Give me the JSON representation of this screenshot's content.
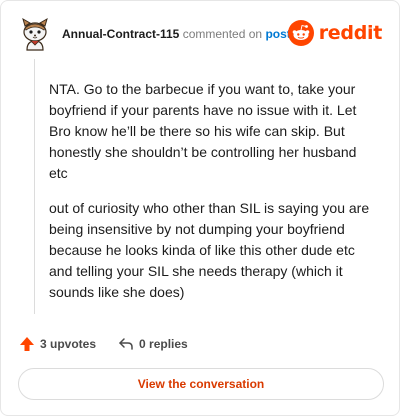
{
  "comment": {
    "username": "Annual-Contract-115",
    "commented_text": "commented on",
    "post_link": "post",
    "paragraphs": [
      "NTA. Go to the barbecue if you want to, take your boyfriend if your parents have no issue with it. Let Bro know he’ll be there so his wife can skip. But honestly she shouldn’t be controlling her husband etc",
      "out of curiosity who other than SIL is saying you are being insensitive by not dumping your boyfriend because he looks kinda of like this other dude etc and telling your SIL she needs therapy (which it sounds like she does)"
    ]
  },
  "brand": {
    "logo_text": "reddit",
    "color": "#ff4500"
  },
  "actions": {
    "upvotes": "3 upvotes",
    "replies": "0 replies",
    "upvote_color": "#ff4500"
  },
  "view_button": {
    "label": "View the conversation",
    "color": "#d93a00"
  },
  "icons": {
    "avatar": "snoo-avatar-icon",
    "logo": "reddit-snoo-icon",
    "upvote": "upvote-arrow-icon",
    "reply": "reply-arrow-icon"
  }
}
